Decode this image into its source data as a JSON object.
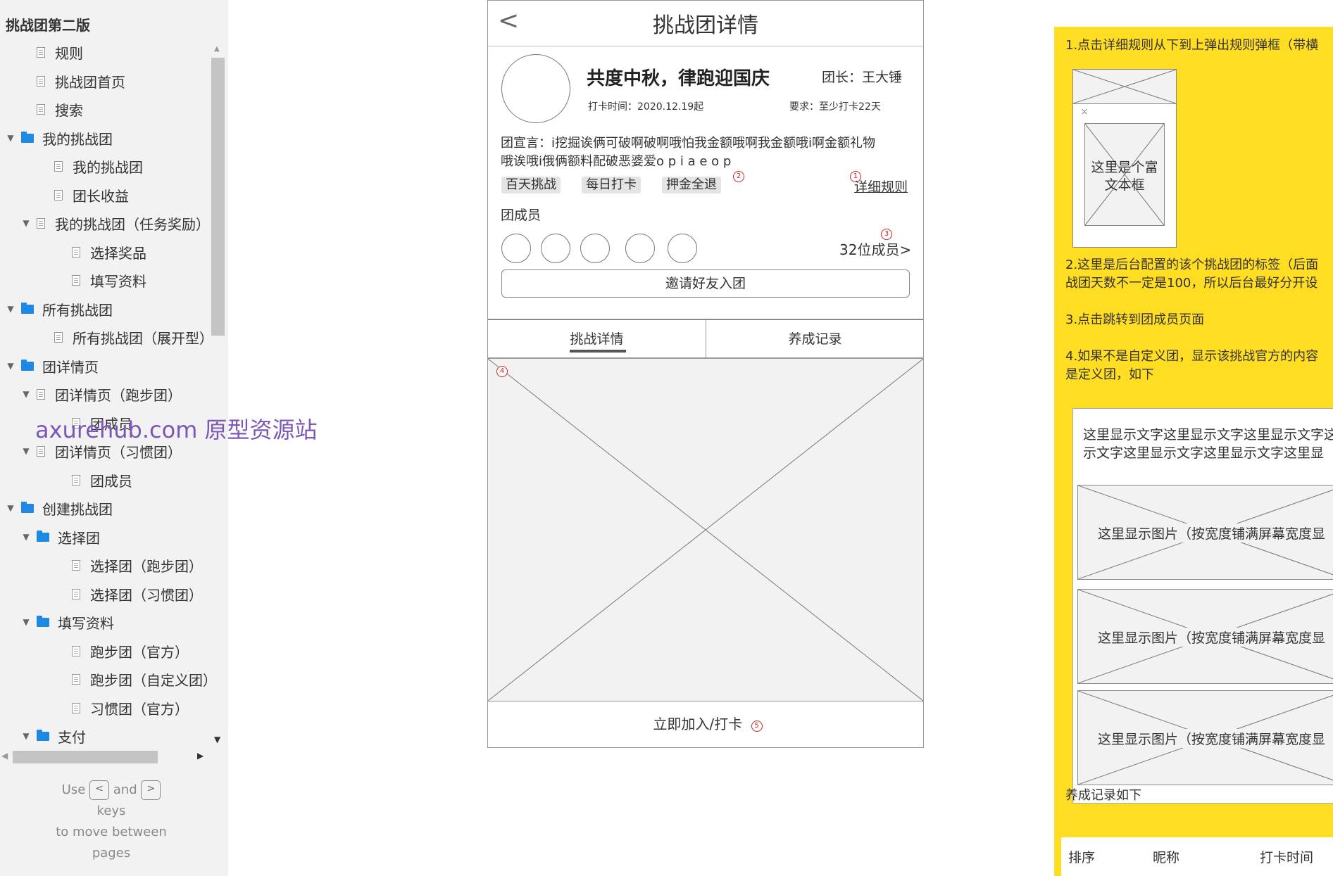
{
  "sidebar": {
    "title": "挑战团第二版",
    "items": [
      {
        "label": "规则",
        "type": "page",
        "level": 1,
        "caret": ""
      },
      {
        "label": "挑战团首页",
        "type": "page",
        "level": 1,
        "caret": ""
      },
      {
        "label": "搜索",
        "type": "page",
        "level": 1,
        "caret": ""
      },
      {
        "label": "我的挑战团",
        "type": "folder",
        "level": 0,
        "caret": "▼"
      },
      {
        "label": "我的挑战团",
        "type": "page",
        "level": 2,
        "caret": ""
      },
      {
        "label": "团长收益",
        "type": "page",
        "level": 2,
        "caret": ""
      },
      {
        "label": "我的挑战团（任务奖励）",
        "type": "page",
        "level": 1,
        "caret": "▼"
      },
      {
        "label": "选择奖品",
        "type": "page",
        "level": 3,
        "caret": ""
      },
      {
        "label": "填写资料",
        "type": "page",
        "level": 3,
        "caret": ""
      },
      {
        "label": "所有挑战团",
        "type": "folder",
        "level": 0,
        "caret": "▼"
      },
      {
        "label": "所有挑战团（展开型）",
        "type": "page",
        "level": 2,
        "caret": ""
      },
      {
        "label": "团详情页",
        "type": "folder",
        "level": 0,
        "caret": "▼"
      },
      {
        "label": "团详情页（跑步团）",
        "type": "page",
        "level": 1,
        "caret": "▼"
      },
      {
        "label": "团成员",
        "type": "page",
        "level": 3,
        "caret": ""
      },
      {
        "label": "团详情页（习惯团）",
        "type": "page",
        "level": 1,
        "caret": "▼"
      },
      {
        "label": "团成员",
        "type": "page",
        "level": 3,
        "caret": ""
      },
      {
        "label": "创建挑战团",
        "type": "folder",
        "level": 0,
        "caret": "▼"
      },
      {
        "label": "选择团",
        "type": "folder",
        "level": 1,
        "caret": "▼"
      },
      {
        "label": "选择团（跑步团）",
        "type": "page",
        "level": 3,
        "caret": ""
      },
      {
        "label": "选择团（习惯团）",
        "type": "page",
        "level": 3,
        "caret": ""
      },
      {
        "label": "填写资料",
        "type": "folder",
        "level": 1,
        "caret": "▼"
      },
      {
        "label": "跑步团（官方）",
        "type": "page",
        "level": 3,
        "caret": ""
      },
      {
        "label": "跑步团（自定义团）",
        "type": "page",
        "level": 3,
        "caret": ""
      },
      {
        "label": "习惯团（官方）",
        "type": "page",
        "level": 3,
        "caret": ""
      },
      {
        "label": "支付",
        "type": "folder",
        "level": 1,
        "caret": "▼"
      }
    ],
    "key_help": {
      "use": "Use",
      "and": "and",
      "keys": "keys",
      "to_move": "to move between",
      "pages": "pages",
      "prev_key": "<",
      "next_key": ">"
    }
  },
  "watermark": "axurehub.com 原型资源站",
  "phone": {
    "nav_title": "挑战团详情",
    "back_glyph": "<",
    "group_name": "共度中秋，律跑迎国庆",
    "leader": "团长：王大锤",
    "checkin_time": "打卡时间：2020.12.19起",
    "requirement": "要求：至少打卡22天",
    "declaration_line1": "团宣言：i挖掘诶俩可破啊破啊哦怕我金额哦啊我金额哦i啊金额礼物",
    "declaration_line2": "哦诶哦i俄俩额料配破恶婆爱o p i a e o p",
    "tags": [
      "百天挑战",
      "每日打卡",
      "押金全退"
    ],
    "rules_link": "详细规则",
    "members_label": "团成员",
    "members_count": "32位成员>",
    "invite_button": "邀请好友入团",
    "tabs": [
      "挑战详情",
      "养成记录"
    ],
    "bottom_button": "立即加入/打卡",
    "markers": [
      "1",
      "2",
      "3",
      "4",
      "5"
    ]
  },
  "notes": {
    "note1": "1.点击详细规则从下到上弹出规则弹框（带横",
    "modal_label": "这里是个富文本框",
    "modal_close": "×",
    "note2_line1": "2.这里是后台配置的该个挑战团的标签（后面",
    "note2_line2": "战团天数不一定是100，所以后台最好分开设",
    "note3": "3.点击跳转到团成员页面",
    "note4_line1": "4.如果不是自定义团，显示该挑战官方的内容",
    "note4_line2": "是定义团，如下",
    "card_text_line1": "这里显示文字这里显示文字这里显示文字这",
    "card_text_line2": "示文字这里显示文字这里显示文字这里显",
    "image_labels": [
      "这里显示图片（按宽度铺满屏幕宽度显",
      "这里显示图片（按宽度铺满屏幕宽度显",
      "这里显示图片（按宽度铺满屏幕宽度显"
    ],
    "footer_partial": "养成记录如下",
    "table_headers": [
      "排序",
      "昵称",
      "打卡时间"
    ]
  }
}
